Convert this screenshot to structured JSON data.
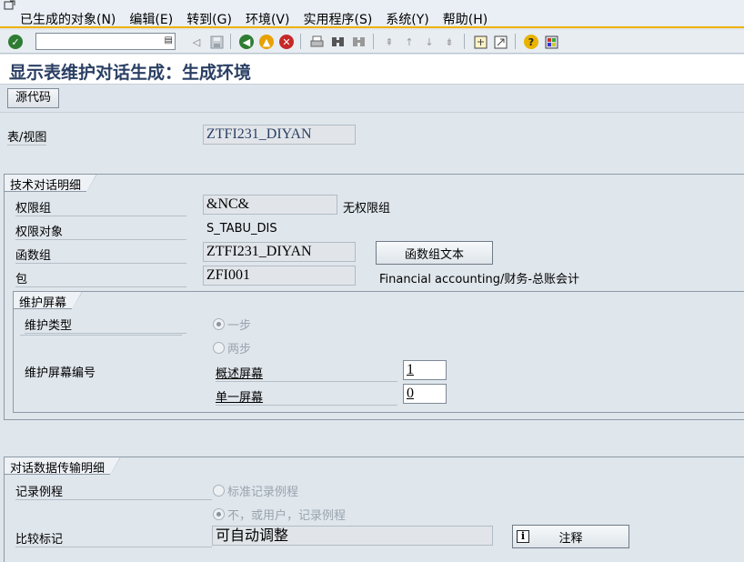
{
  "menu": {
    "items": [
      "已生成的对象(N)",
      "编辑(E)",
      "转到(G)",
      "环境(V)",
      "实用程序(S)",
      "系统(Y)",
      "帮助(H)"
    ]
  },
  "toolbar": {
    "command_value": "",
    "icons": [
      "enter-icon",
      "save-icon",
      "back-icon",
      "exit-icon",
      "cancel-icon",
      "print-icon",
      "find-icon",
      "find-next-icon",
      "first-page-icon",
      "prev-page-icon",
      "next-page-icon",
      "last-page-icon",
      "new-session-icon",
      "shortcut-icon",
      "help-icon",
      "layout-icon"
    ]
  },
  "title": "显示表维护对话生成：生成环境",
  "app_toolbar": {
    "source_code_button": "源代码"
  },
  "table_view": {
    "label": "表/视图",
    "value": "ZTFI231_DIYAN"
  },
  "tech_group": {
    "title": "技术对话明细",
    "auth_group_label": "权限组",
    "auth_group_value": "&NC&",
    "auth_group_text": "无权限组",
    "auth_object_label": "权限对象",
    "auth_object_value": "S_TABU_DIS",
    "function_group_label": "函数组",
    "function_group_value": "ZTFI231_DIYAN",
    "function_group_text_button": "函数组文本",
    "package_label": "包",
    "package_value": "ZFI001",
    "package_text": "Financial accounting/财务-总账会计"
  },
  "screen_group": {
    "title": "维护屏幕",
    "maint_type_label": "维护类型",
    "one_step": "一步",
    "two_step": "两步",
    "screen_no_label": "维护屏幕编号",
    "overview_label": "概述屏幕",
    "overview_value": "1",
    "single_label": "单一屏幕",
    "single_value": "0"
  },
  "transport_group": {
    "title": "对话数据传输明细",
    "record_routine_label": "记录例程",
    "standard_routine": "标准记录例程",
    "no_user_routine": "不，或用户，记录例程",
    "compare_flag_label": "比较标记",
    "compare_flag_value": "可自动调整",
    "note_button": "注释"
  }
}
